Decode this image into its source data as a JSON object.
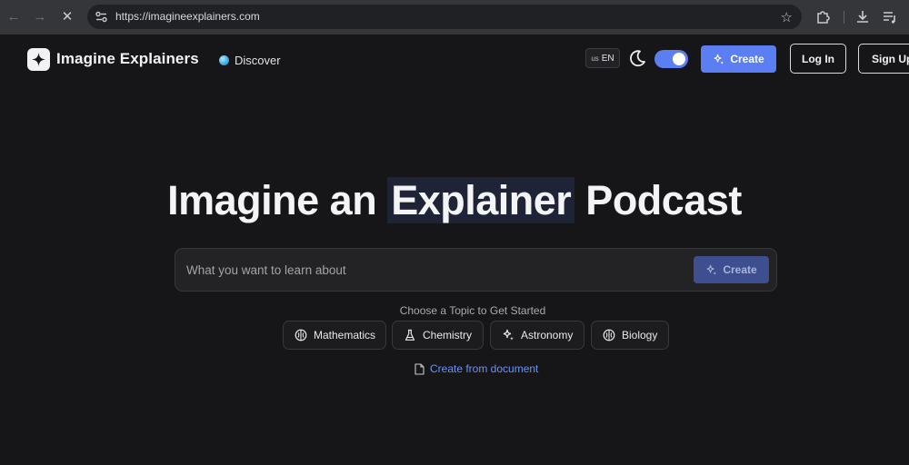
{
  "browser": {
    "url": "https://imagineexplainers.com"
  },
  "header": {
    "brand": "Imagine Explainers",
    "discover_label": "Discover",
    "lang_flag": "us",
    "lang_code": "EN",
    "create_label": "Create",
    "login_label": "Log In",
    "signup_label": "Sign Up",
    "accent_color": "#5b7ff2",
    "theme_toggle_on": true
  },
  "hero": {
    "title_before": "Imagine an ",
    "title_highlight": "Explainer",
    "title_after": " Podcast"
  },
  "search": {
    "placeholder": "What you want to learn about",
    "button_label": "Create"
  },
  "topics": {
    "heading": "Choose a Topic to Get Started",
    "items": [
      {
        "label": "Mathematics",
        "icon": "brain-icon"
      },
      {
        "label": "Chemistry",
        "icon": "flask-icon"
      },
      {
        "label": "Astronomy",
        "icon": "sparkles-icon"
      },
      {
        "label": "Biology",
        "icon": "brain-icon"
      }
    ]
  },
  "document_link": "Create from document"
}
